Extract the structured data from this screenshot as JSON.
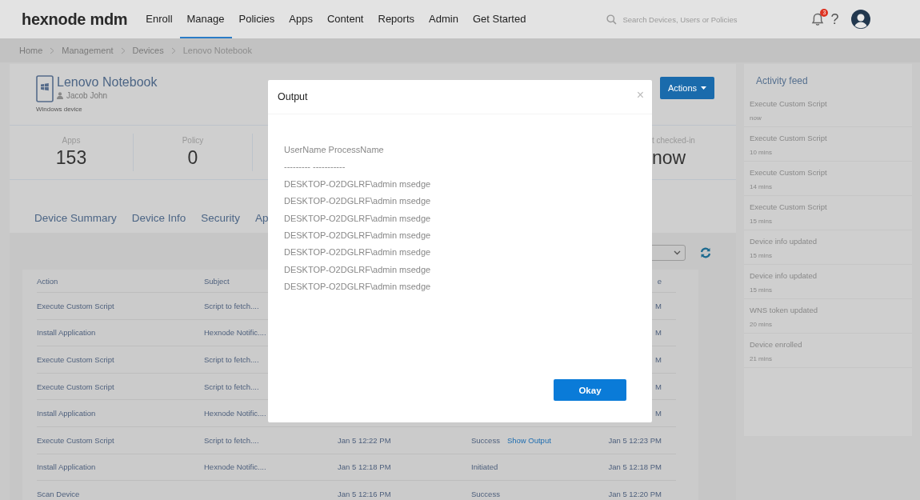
{
  "brand": "hexnode mdm",
  "nav": [
    {
      "label": "Enroll",
      "selected": false
    },
    {
      "label": "Manage",
      "selected": true
    },
    {
      "label": "Policies",
      "selected": false
    },
    {
      "label": "Apps",
      "selected": false
    },
    {
      "label": "Content",
      "selected": false
    },
    {
      "label": "Reports",
      "selected": false
    },
    {
      "label": "Admin",
      "selected": false
    },
    {
      "label": "Get Started",
      "selected": false
    }
  ],
  "search": {
    "placeholder": "Search Devices, Users or Policies"
  },
  "notifications": {
    "count": "3"
  },
  "help": "?",
  "breadcrumb": [
    "Home",
    "Management",
    "Devices",
    "Lenovo Notebook"
  ],
  "device": {
    "name": "Lenovo Notebook",
    "user": "Jacob John",
    "type": "Windows device"
  },
  "actions_button": "Actions",
  "stats": [
    {
      "label": "Apps",
      "value": "153"
    },
    {
      "label": "Policy",
      "value": "0"
    }
  ],
  "last_checkin": {
    "label": "t checked-in",
    "value": "now"
  },
  "tabs": [
    {
      "label": "Device Summary",
      "selected": false
    },
    {
      "label": "Device Info",
      "selected": false
    },
    {
      "label": "Security",
      "selected": false
    },
    {
      "label": "Ap",
      "selected": false
    }
  ],
  "table": {
    "columns": {
      "action": "Action",
      "subject": "Subject",
      "updated": "e"
    },
    "rows": [
      {
        "action": "Execute Custom Script",
        "subject": "Script to fetch....",
        "updated": "M"
      },
      {
        "action": "Install Application",
        "subject": "Hexnode Notific....",
        "updated": "M"
      },
      {
        "action": "Execute Custom Script",
        "subject": "Script to fetch....",
        "updated": "M"
      },
      {
        "action": "Execute Custom Script",
        "subject": "Script to fetch....",
        "updated": "M"
      },
      {
        "action": "Install Application",
        "subject": "Hexnode Notific....",
        "updated": "M"
      },
      {
        "action": "Execute Custom Script",
        "subject": "Script to fetch....",
        "date": "Jan 5 12:22 PM",
        "status": "Success",
        "link": "Show Output",
        "updated": "Jan 5 12:23 PM"
      },
      {
        "action": "Install Application",
        "subject": "Hexnode Notific....",
        "date": "Jan 5 12:18 PM",
        "status": "Initiated",
        "updated": "Jan 5 12:18 PM"
      },
      {
        "action": "Scan Device",
        "date": "Jan 5 12:16 PM",
        "status": "Success",
        "updated": "Jan 5 12:20 PM"
      }
    ]
  },
  "activity_feed": {
    "title": "Activity feed",
    "items": [
      {
        "title": "Execute Custom Script",
        "time": "now"
      },
      {
        "title": "Execute Custom Script",
        "time": "10 mins"
      },
      {
        "title": "Execute Custom Script",
        "time": "14 mins"
      },
      {
        "title": "Execute Custom Script",
        "time": "15 mins"
      },
      {
        "title": "Device info updated",
        "time": "15 mins"
      },
      {
        "title": "Device info updated",
        "time": "15 mins"
      },
      {
        "title": "WNS token updated",
        "time": "20 mins"
      },
      {
        "title": "Device enrolled",
        "time": "21 mins"
      }
    ]
  },
  "dialog": {
    "title": "Output",
    "close": "×",
    "lines": [
      "UserName ProcessName",
      "--------- -----------",
      "DESKTOP-O2DGLRF\\admin msedge",
      "DESKTOP-O2DGLRF\\admin msedge",
      "DESKTOP-O2DGLRF\\admin msedge",
      "DESKTOP-O2DGLRF\\admin msedge",
      "DESKTOP-O2DGLRF\\admin msedge",
      "DESKTOP-O2DGLRF\\admin msedge",
      "DESKTOP-O2DGLRF\\admin msedge"
    ],
    "button": "Okay"
  }
}
